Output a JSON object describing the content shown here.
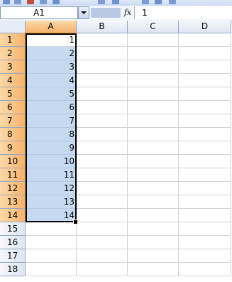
{
  "formula_bar": {
    "name_box": "A1",
    "fx_label": "fx",
    "value": "1"
  },
  "columns": [
    "A",
    "B",
    "C",
    "D"
  ],
  "rows": [
    "1",
    "2",
    "3",
    "4",
    "5",
    "6",
    "7",
    "8",
    "9",
    "10",
    "11",
    "12",
    "13",
    "14",
    "15",
    "16",
    "17",
    "18"
  ],
  "column_a_values": [
    "1",
    "2",
    "3",
    "4",
    "5",
    "6",
    "7",
    "8",
    "9",
    "10",
    "11",
    "12",
    "13",
    "14"
  ],
  "colors": {
    "selection": "#c5d9f1",
    "header_selected": "#f6b26b",
    "grid_line": "#d4d4d4"
  }
}
